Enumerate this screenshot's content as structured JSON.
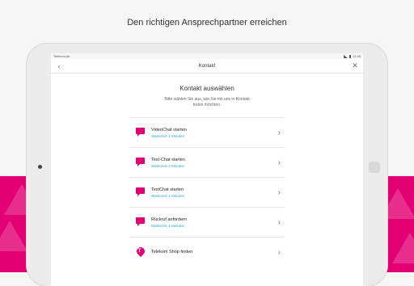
{
  "headline": "Den richtigen Ansprechpartner erreichen",
  "statusbar": {
    "left": "Telekom.de",
    "time": "11:55"
  },
  "appbar": {
    "title": "Kontakt",
    "back_icon": "chevron-left-icon",
    "close_icon": "close-icon"
  },
  "heading": "Kontakt auswählen",
  "subtitle": "Bitte wählen Sie aus, wie Sie mit uns in Kontakt treten möchten.",
  "items": [
    {
      "label": "VideoChat starten",
      "wait": "Wartezeit: 2 Minuten",
      "icon": "video-chat-icon"
    },
    {
      "label": "Text-Chat starten",
      "wait": "Wartezeit: 1 Minuten",
      "icon": "text-chat-icon"
    },
    {
      "label": "TextChat starten",
      "wait": "Wartezeit: 1 Minuten",
      "icon": "chat-icon"
    },
    {
      "label": "Rückruf anfordern",
      "wait": "Wartezeit: 1 Minuten",
      "icon": "callback-icon"
    },
    {
      "label": "Telekom Shop finden",
      "wait": "",
      "icon": "location-pin-icon"
    }
  ],
  "colors": {
    "brand": "#e20074",
    "accent": "#2aa3c9"
  }
}
